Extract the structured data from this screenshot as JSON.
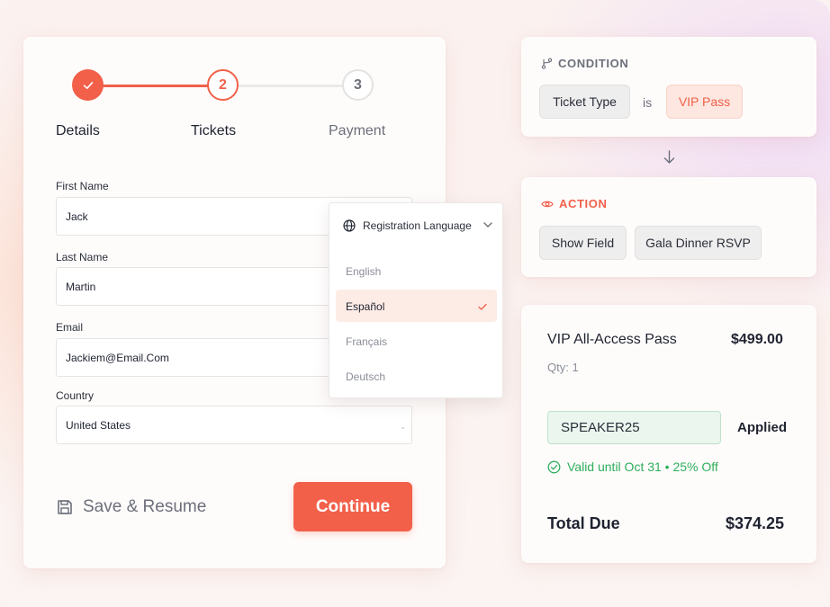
{
  "stepper": {
    "steps": [
      {
        "number": "",
        "label": "Details",
        "state": "completed"
      },
      {
        "number": "2",
        "label": "Tickets",
        "state": "active"
      },
      {
        "number": "3",
        "label": "Payment",
        "state": "upcoming"
      }
    ]
  },
  "form": {
    "first_name": {
      "label": "First Name",
      "value": "Jack"
    },
    "last_name": {
      "label": "Last Name",
      "value": "Martin"
    },
    "email": {
      "label": "Email",
      "value": "Jackiem@Email.Com"
    },
    "country": {
      "label": "Country",
      "value": "United States"
    },
    "save_label": "Save & Resume",
    "continue_label": "Continue"
  },
  "language_dropdown": {
    "title": "Registration Language",
    "options": [
      "English",
      "Español",
      "Français",
      "Deutsch"
    ],
    "selected": "Español"
  },
  "condition": {
    "header": "CONDITION",
    "field": "Ticket Type",
    "operator": "is",
    "value": "VIP Pass"
  },
  "action": {
    "header": "ACTION",
    "verb": "Show Field",
    "target": "Gala Dinner RSVP"
  },
  "summary": {
    "item_name": "VIP All-Access Pass",
    "item_price": "$499.00",
    "quantity": "Qty: 1",
    "promo_code": "SPEAKER25",
    "promo_status": "Applied",
    "promo_note": "Valid until Oct 31 • 25% Off",
    "total_label": "Total Due",
    "total_value": "$374.25"
  },
  "colors": {
    "accent": "#f2604a",
    "success": "#2fae5c",
    "muted_text": "#8b8e98"
  }
}
